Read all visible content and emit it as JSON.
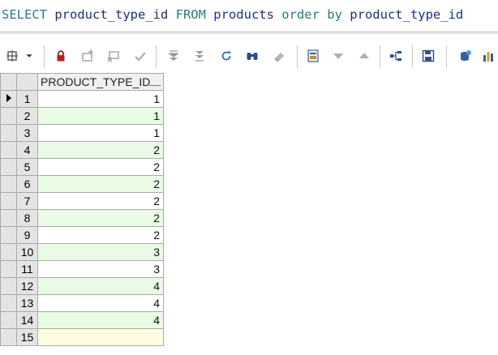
{
  "editor": {
    "sql_parts": [
      {
        "text": "SELECT",
        "kind": "kw"
      },
      {
        "text": " product_type_id ",
        "kind": "id"
      },
      {
        "text": "FROM",
        "kind": "kw"
      },
      {
        "text": " products ",
        "kind": "id"
      },
      {
        "text": "order by",
        "kind": "kw"
      },
      {
        "text": " product_type_id",
        "kind": "id"
      }
    ]
  },
  "toolbar": {
    "icons": [
      "grid-settings-icon",
      "dropdown-arrow-icon",
      "lock-icon",
      "add-record-icon",
      "delete-record-icon",
      "post-checkmark-icon",
      "first-page-icon",
      "last-page-icon",
      "refresh-icon",
      "find-binoculars-icon",
      "clear-eraser-icon",
      "single-record-view-icon",
      "sort-down-icon",
      "sort-up-icon",
      "query-tree-icon",
      "save-disk-icon",
      "export-database-icon",
      "bar-chart-icon"
    ]
  },
  "grid": {
    "columns": [
      "PRODUCT_TYPE_ID"
    ],
    "rows": [
      {
        "num": "1",
        "value": "1",
        "current": true
      },
      {
        "num": "2",
        "value": "1"
      },
      {
        "num": "3",
        "value": "1"
      },
      {
        "num": "4",
        "value": "2"
      },
      {
        "num": "5",
        "value": "2"
      },
      {
        "num": "6",
        "value": "2"
      },
      {
        "num": "7",
        "value": "2"
      },
      {
        "num": "8",
        "value": "2"
      },
      {
        "num": "9",
        "value": "2"
      },
      {
        "num": "10",
        "value": "3"
      },
      {
        "num": "11",
        "value": "3"
      },
      {
        "num": "12",
        "value": "4"
      },
      {
        "num": "13",
        "value": "4"
      },
      {
        "num": "14",
        "value": "4"
      },
      {
        "num": "15",
        "value": ""
      }
    ],
    "colors": {
      "even_row": "#e9fbe5",
      "odd_row": "#ffffff",
      "new_row": "#fffde0"
    }
  }
}
